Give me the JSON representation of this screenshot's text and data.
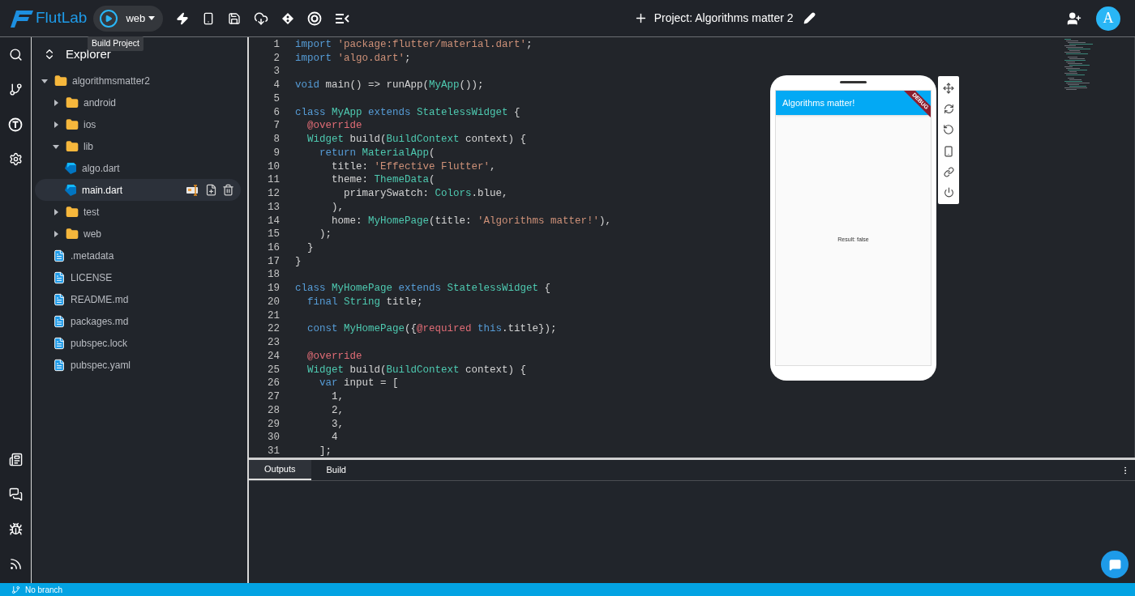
{
  "topbar": {
    "logo": "FlutLab",
    "platform": "web",
    "tooltip": "Build Project",
    "project_title": "Project: Algorithms matter 2",
    "avatar": "A"
  },
  "explorer": {
    "title": "Explorer",
    "tree": [
      {
        "name": "algorithmsmatter2",
        "kind": "folder",
        "expanded": true,
        "selected": false,
        "children": [
          {
            "name": "android",
            "kind": "folder",
            "expanded": false,
            "selected": false
          },
          {
            "name": "ios",
            "kind": "folder",
            "expanded": false,
            "selected": false
          },
          {
            "name": "lib",
            "kind": "folder",
            "expanded": true,
            "selected": false,
            "children": [
              {
                "name": "algo.dart",
                "kind": "dart",
                "selected": false
              },
              {
                "name": "main.dart",
                "kind": "dart",
                "selected": true
              }
            ]
          },
          {
            "name": "test",
            "kind": "folder",
            "expanded": false,
            "selected": false
          },
          {
            "name": "web",
            "kind": "folder",
            "expanded": false,
            "selected": false
          },
          {
            "name": ".metadata",
            "kind": "doc",
            "selected": false
          },
          {
            "name": "LICENSE",
            "kind": "doc",
            "selected": false
          },
          {
            "name": "README.md",
            "kind": "doc",
            "selected": false
          },
          {
            "name": "packages.md",
            "kind": "doc",
            "selected": false
          },
          {
            "name": "pubspec.lock",
            "kind": "doc",
            "selected": false
          },
          {
            "name": "pubspec.yaml",
            "kind": "doc",
            "selected": false
          }
        ]
      }
    ]
  },
  "editor": {
    "lines": [
      {
        "n": "1",
        "code": [
          {
            "kind": "keyword",
            "text": "import"
          },
          {
            "kind": "string",
            "text": " 'package:flutter/material.dart'"
          },
          {
            "kind": "plain",
            "text": ";"
          }
        ]
      },
      {
        "n": "2",
        "code": [
          {
            "kind": "keyword",
            "text": "import"
          },
          {
            "kind": "string",
            "text": " 'algo.dart'"
          },
          {
            "kind": "plain",
            "text": ";"
          }
        ]
      },
      {
        "n": "3"
      },
      {
        "n": "4",
        "code": [
          {
            "kind": "keyword",
            "text": "void"
          },
          {
            "kind": "plain",
            "text": " main() => runApp("
          },
          {
            "kind": "type",
            "text": "MyApp"
          },
          {
            "kind": "plain",
            "text": "());"
          }
        ]
      },
      {
        "n": "5"
      },
      {
        "n": "6",
        "code": [
          {
            "kind": "keyword",
            "text": "class"
          },
          {
            "kind": "type",
            "text": " MyApp"
          },
          {
            "kind": "keyword",
            "text": " extends"
          },
          {
            "kind": "type",
            "text": " StatelessWidget"
          },
          {
            "kind": "plain",
            "text": " {"
          }
        ]
      },
      {
        "n": "7",
        "code": [
          {
            "kind": "annotation",
            "text": "  @override"
          }
        ]
      },
      {
        "n": "8",
        "code": [
          {
            "kind": "type",
            "text": "  Widget"
          },
          {
            "kind": "plain",
            "text": " build("
          },
          {
            "kind": "type",
            "text": "BuildContext"
          },
          {
            "kind": "plain",
            "text": " context) {"
          }
        ]
      },
      {
        "n": "9",
        "code": [
          {
            "kind": "keyword",
            "text": "    return"
          },
          {
            "kind": "type",
            "text": " MaterialApp"
          },
          {
            "kind": "plain",
            "text": "("
          }
        ]
      },
      {
        "n": "10",
        "code": [
          {
            "kind": "plain",
            "text": "      title: "
          },
          {
            "kind": "string",
            "text": "'Effective Flutter'"
          },
          {
            "kind": "plain",
            "text": ","
          }
        ]
      },
      {
        "n": "11",
        "code": [
          {
            "kind": "plain",
            "text": "      theme: "
          },
          {
            "kind": "type",
            "text": "ThemeData"
          },
          {
            "kind": "plain",
            "text": "("
          }
        ]
      },
      {
        "n": "12",
        "code": [
          {
            "kind": "plain",
            "text": "        primarySwatch: "
          },
          {
            "kind": "type",
            "text": "Colors"
          },
          {
            "kind": "plain",
            "text": ".blue,"
          }
        ]
      },
      {
        "n": "13",
        "code": [
          {
            "kind": "plain",
            "text": "      ),"
          }
        ]
      },
      {
        "n": "14",
        "code": [
          {
            "kind": "plain",
            "text": "      home: "
          },
          {
            "kind": "type",
            "text": "MyHomePage"
          },
          {
            "kind": "plain",
            "text": "(title: "
          },
          {
            "kind": "string",
            "text": "'Algorithms matter!'"
          },
          {
            "kind": "plain",
            "text": "),"
          }
        ]
      },
      {
        "n": "15",
        "code": [
          {
            "kind": "plain",
            "text": "    );"
          }
        ]
      },
      {
        "n": "16",
        "code": [
          {
            "kind": "plain",
            "text": "  }"
          }
        ]
      },
      {
        "n": "17",
        "code": [
          {
            "kind": "plain",
            "text": "}"
          }
        ]
      },
      {
        "n": "18"
      },
      {
        "n": "19",
        "code": [
          {
            "kind": "keyword",
            "text": "class"
          },
          {
            "kind": "type",
            "text": " MyHomePage"
          },
          {
            "kind": "keyword",
            "text": " extends"
          },
          {
            "kind": "type",
            "text": " StatelessWidget"
          },
          {
            "kind": "plain",
            "text": " {"
          }
        ]
      },
      {
        "n": "20",
        "code": [
          {
            "kind": "keyword",
            "text": "  final"
          },
          {
            "kind": "type",
            "text": " String"
          },
          {
            "kind": "plain",
            "text": " title;"
          }
        ]
      },
      {
        "n": "21"
      },
      {
        "n": "22",
        "code": [
          {
            "kind": "keyword",
            "text": "  const"
          },
          {
            "kind": "type",
            "text": " MyHomePage"
          },
          {
            "kind": "plain",
            "text": "({"
          },
          {
            "kind": "annotation",
            "text": "@required"
          },
          {
            "kind": "keyword",
            "text": " this"
          },
          {
            "kind": "plain",
            "text": ".title});"
          }
        ]
      },
      {
        "n": "23"
      },
      {
        "n": "24",
        "code": [
          {
            "kind": "annotation",
            "text": "  @override"
          }
        ]
      },
      {
        "n": "25",
        "code": [
          {
            "kind": "type",
            "text": "  Widget"
          },
          {
            "kind": "plain",
            "text": " build("
          },
          {
            "kind": "type",
            "text": "BuildContext"
          },
          {
            "kind": "plain",
            "text": " context) {"
          }
        ]
      },
      {
        "n": "26",
        "code": [
          {
            "kind": "keyword",
            "text": "    var"
          },
          {
            "kind": "plain",
            "text": " input = ["
          }
        ]
      },
      {
        "n": "27",
        "code": [
          {
            "kind": "plain",
            "text": "      1,"
          }
        ]
      },
      {
        "n": "28",
        "code": [
          {
            "kind": "plain",
            "text": "      2,"
          }
        ]
      },
      {
        "n": "29",
        "code": [
          {
            "kind": "plain",
            "text": "      3,"
          }
        ]
      },
      {
        "n": "30",
        "code": [
          {
            "kind": "plain",
            "text": "      4"
          }
        ]
      },
      {
        "n": "31",
        "code": [
          {
            "kind": "plain",
            "text": "    ];"
          }
        ]
      }
    ]
  },
  "preview": {
    "app_title": "Algorithms matter!",
    "banner": "DEBUG",
    "body": "Result: false"
  },
  "output": {
    "tabs": [
      {
        "label": "Outputs",
        "selected": true
      },
      {
        "label": "Build",
        "selected": false
      }
    ]
  },
  "status_bar": {
    "branch": "No branch"
  }
}
